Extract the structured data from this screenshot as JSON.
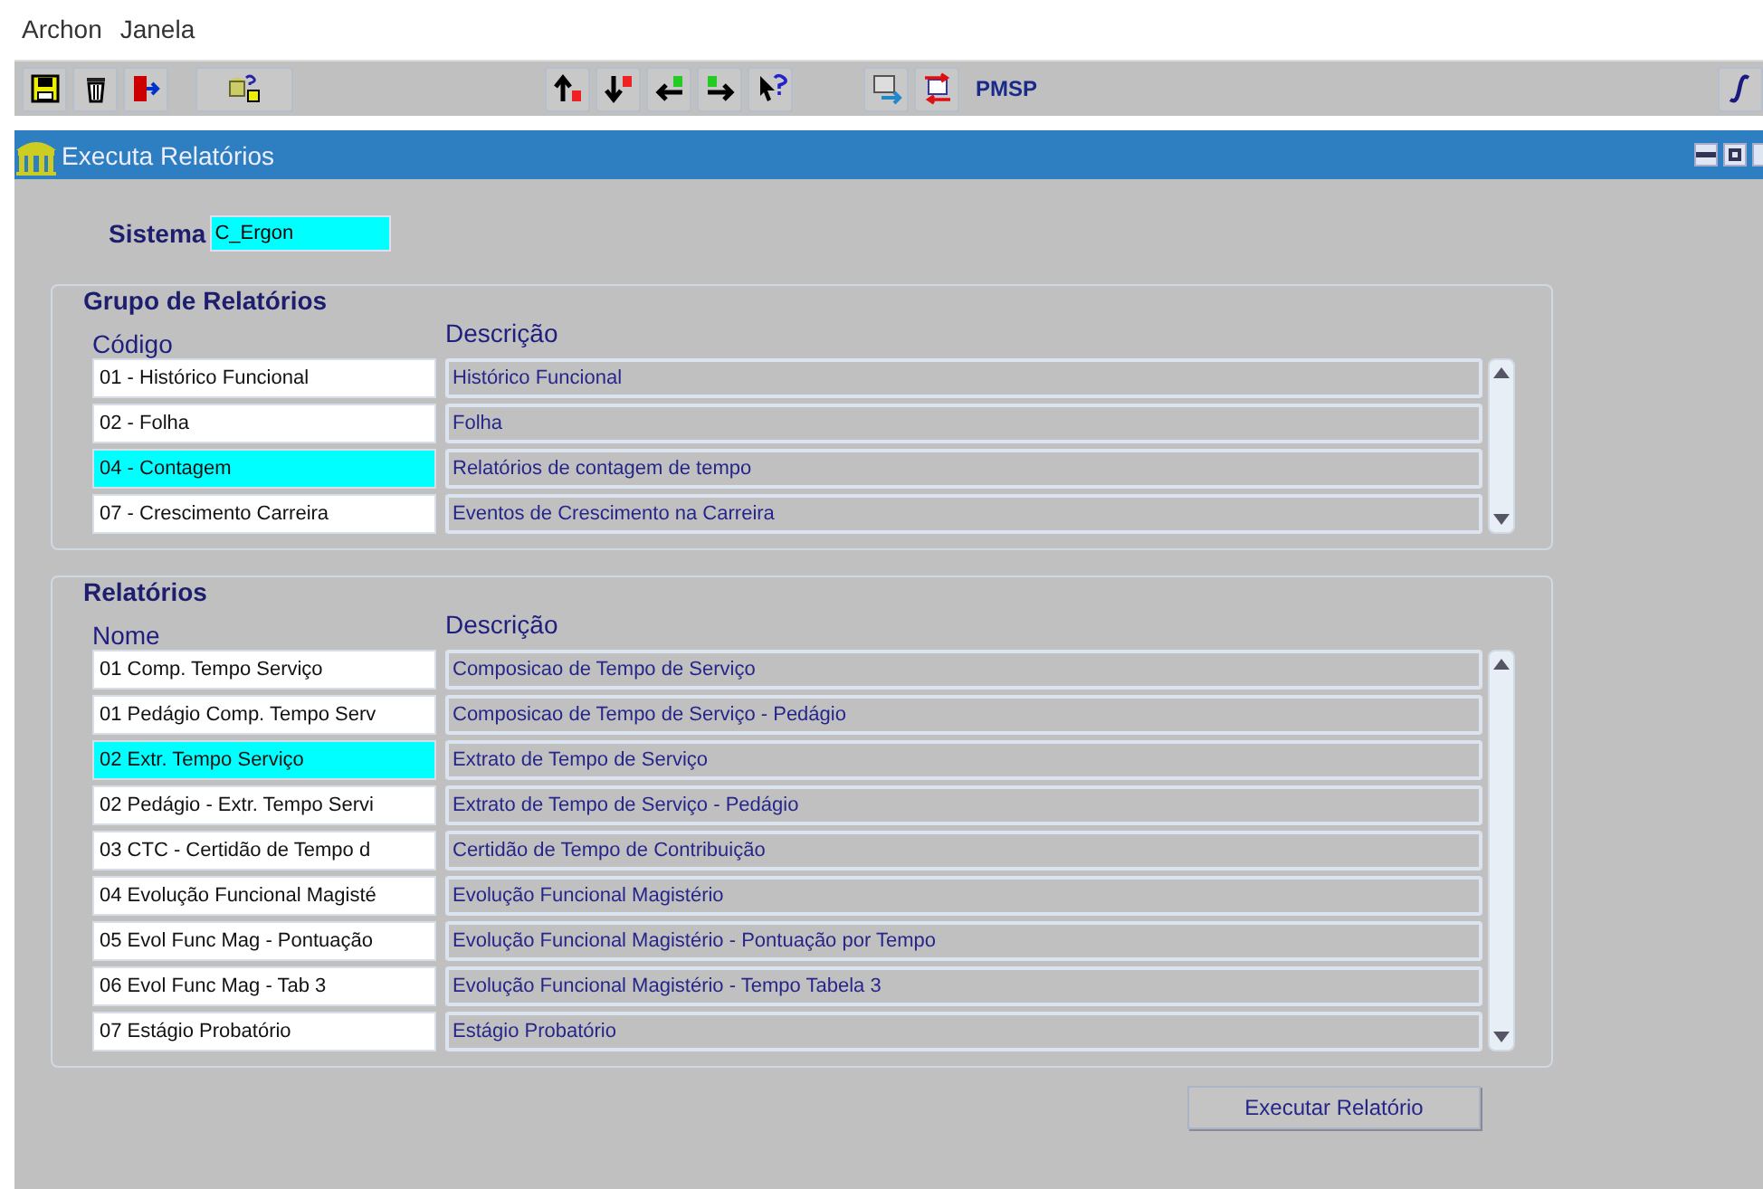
{
  "menu": [
    {
      "label": "Archon"
    },
    {
      "label": "Janela"
    }
  ],
  "toolbar": {
    "brand": "PMSP"
  },
  "window": {
    "title": "Executa Relatórios"
  },
  "sistema": {
    "label": "Sistema",
    "value": "C_Ergon"
  },
  "groups": [
    {
      "title": "Grupo de Relatórios",
      "columns": [
        "Código",
        "Descrição"
      ],
      "rows": [
        {
          "code": "01 - Histórico Funcional",
          "description": "Histórico Funcional",
          "selected": false
        },
        {
          "code": "02 - Folha",
          "description": "Folha",
          "selected": false
        },
        {
          "code": "04 - Contagem",
          "description": "Relatórios de contagem de tempo",
          "selected": true
        },
        {
          "code": "07 - Crescimento Carreira",
          "description": "Eventos de Crescimento na Carreira",
          "selected": false
        }
      ]
    },
    {
      "title": "Relatórios",
      "columns": [
        "Nome",
        "Descrição"
      ],
      "rows": [
        {
          "code": "01 Comp. Tempo Serviço",
          "description": "Composicao de Tempo de Serviço",
          "selected": false
        },
        {
          "code": "01 Pedágio Comp. Tempo Serv",
          "description": "Composicao de Tempo de Serviço - Pedágio",
          "selected": false
        },
        {
          "code": "02 Extr. Tempo Serviço",
          "description": "Extrato de Tempo de Serviço",
          "selected": true
        },
        {
          "code": "02 Pedágio - Extr. Tempo Servi",
          "description": "Extrato de Tempo de Serviço - Pedágio",
          "selected": false
        },
        {
          "code": "03 CTC - Certidão de Tempo d",
          "description": "Certidão de Tempo de Contribuição",
          "selected": false
        },
        {
          "code": "04 Evolução Funcional Magisté",
          "description": "Evolução Funcional Magistério",
          "selected": false
        },
        {
          "code": "05 Evol Func Mag - Pontuação",
          "description": "Evolução Funcional Magistério - Pontuação por Tempo",
          "selected": false
        },
        {
          "code": "06 Evol Func Mag - Tab 3",
          "description": "Evolução Funcional Magistério - Tempo Tabela 3",
          "selected": false
        },
        {
          "code": "07 Estágio Probatório",
          "description": "Estágio Probatório",
          "selected": false
        }
      ]
    }
  ],
  "run_button": {
    "label": "Executar Relatório"
  }
}
